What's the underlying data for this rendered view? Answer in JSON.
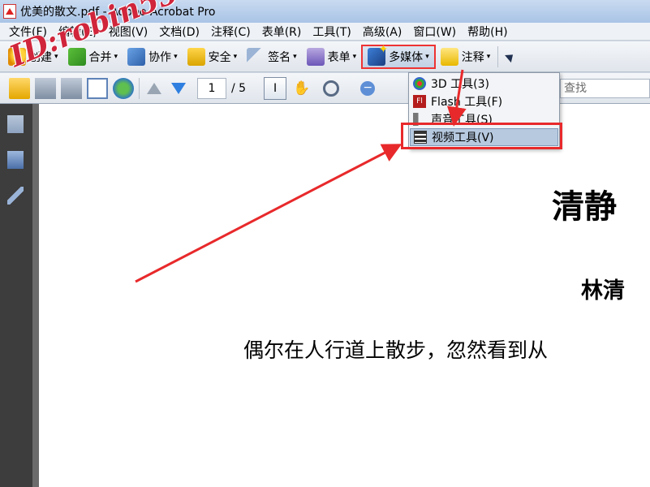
{
  "window": {
    "title": "优美的散文.pdf - Adobe Acrobat Pro"
  },
  "menubar": {
    "items": [
      "文件(F)",
      "编辑(E)",
      "视图(V)",
      "文档(D)",
      "注释(C)",
      "表单(R)",
      "工具(T)",
      "高级(A)",
      "窗口(W)",
      "帮助(H)"
    ]
  },
  "toolbar1": {
    "create": "创建",
    "combine": "合并",
    "collaborate": "协作",
    "secure": "安全",
    "sign": "签名",
    "forms": "表单",
    "multimedia": "多媒体",
    "comment": "注释"
  },
  "toolbar2": {
    "current_page": "1",
    "page_total": "/ 5",
    "search_placeholder": "查找"
  },
  "multimedia_menu": {
    "items": [
      {
        "label": "3D 工具(3)",
        "icon": "3d-icon"
      },
      {
        "label": "Flash 工具(F)",
        "icon": "flash-icon"
      },
      {
        "label": "声音工具(S)",
        "icon": "sound-icon"
      },
      {
        "label": "视频工具(V)",
        "icon": "video-icon",
        "highlighted": true
      }
    ]
  },
  "document": {
    "title": "清静",
    "author": "林清",
    "body_line": "偶尔在人行道上散步，忽然看到从"
  },
  "watermark": {
    "text": "ID:robin553"
  },
  "colors": {
    "annotation_red": "#e8292b",
    "menu_highlight": "#b6c9df"
  }
}
